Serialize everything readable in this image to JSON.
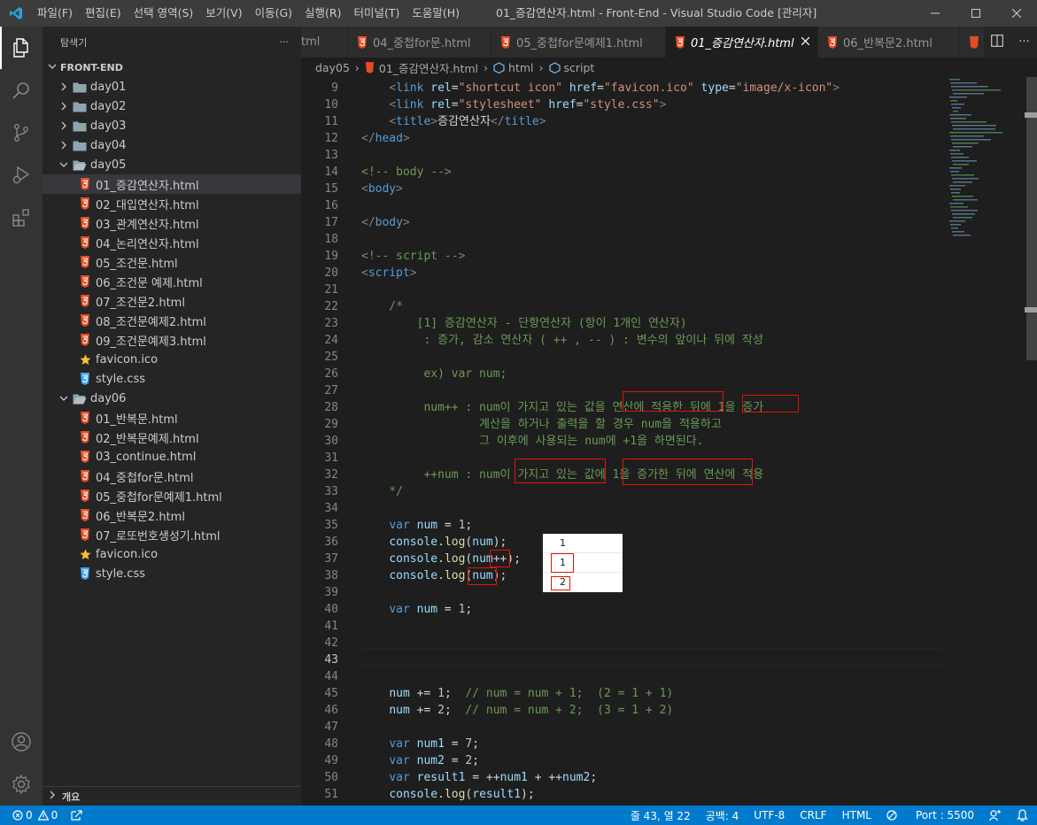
{
  "title_bar": {
    "menu": [
      "파일(F)",
      "편집(E)",
      "선택 영역(S)",
      "보기(V)",
      "이동(G)",
      "실행(R)",
      "터미널(T)",
      "도움말(H)"
    ],
    "window_title": "01_증감연산자.html - Front-End - Visual Studio Code [관리자]"
  },
  "sidebar": {
    "header": "탐색기",
    "more": "···",
    "root": "FRONT-END",
    "items": [
      {
        "label": "day01",
        "type": "folder-closed",
        "indent": 0
      },
      {
        "label": "day02",
        "type": "folder-closed",
        "indent": 0
      },
      {
        "label": "day03",
        "type": "folder-closed",
        "indent": 0
      },
      {
        "label": "day04",
        "type": "folder-closed",
        "indent": 0
      },
      {
        "label": "day05",
        "type": "folder-open",
        "indent": 0
      },
      {
        "label": "01_증감연산자.html",
        "type": "html",
        "indent": 1,
        "selected": true
      },
      {
        "label": "02_대입연산자.html",
        "type": "html",
        "indent": 1
      },
      {
        "label": "03_관계연산자.html",
        "type": "html",
        "indent": 1
      },
      {
        "label": "04_논리연산자.html",
        "type": "html",
        "indent": 1
      },
      {
        "label": "05_조건문.html",
        "type": "html",
        "indent": 1
      },
      {
        "label": "06_조건문 예제.html",
        "type": "html",
        "indent": 1
      },
      {
        "label": "07_조건문2.html",
        "type": "html",
        "indent": 1
      },
      {
        "label": "08_조건문예제2.html",
        "type": "html",
        "indent": 1
      },
      {
        "label": "09_조건문예제3.html",
        "type": "html",
        "indent": 1
      },
      {
        "label": "favicon.ico",
        "type": "star",
        "indent": 1
      },
      {
        "label": "style.css",
        "type": "css",
        "indent": 1
      },
      {
        "label": "day06",
        "type": "folder-open",
        "indent": 0
      },
      {
        "label": "01_반복문.html",
        "type": "html",
        "indent": 1
      },
      {
        "label": "02_반복문예제.html",
        "type": "html",
        "indent": 1
      },
      {
        "label": "03_continue.html",
        "type": "html",
        "indent": 1
      },
      {
        "label": "04_중첩for문.html",
        "type": "html",
        "indent": 1
      },
      {
        "label": "05_중첩for문예제1.html",
        "type": "html",
        "indent": 1
      },
      {
        "label": "06_반복문2.html",
        "type": "html",
        "indent": 1
      },
      {
        "label": "07_로또번호생성기.html",
        "type": "html",
        "indent": 1
      },
      {
        "label": "favicon.ico",
        "type": "star",
        "indent": 1
      },
      {
        "label": "style.css",
        "type": "css",
        "indent": 1
      }
    ],
    "footer": "개요"
  },
  "tabs": [
    {
      "label": "tml",
      "icon": false
    },
    {
      "label": "04_중첩for문.html",
      "icon": true
    },
    {
      "label": "05_중첩for문예제1.html",
      "icon": true
    },
    {
      "label": "01_증감연산자.html",
      "icon": true,
      "active": true
    },
    {
      "label": "06_반복문2.html",
      "icon": true
    }
  ],
  "breadcrumb": {
    "folder": "day05",
    "file": "01_증감연산자.html",
    "node1": "html",
    "node2": "script"
  },
  "editor": {
    "current_line": "43",
    "lines": [
      {
        "n": "9",
        "t": [
          [
            "pl",
            "    "
          ],
          [
            "br",
            "<"
          ],
          [
            "tg",
            "link"
          ],
          [
            "pl",
            " "
          ],
          [
            "at",
            "rel"
          ],
          [
            "pl",
            "="
          ],
          [
            "st",
            "\"shortcut icon\""
          ],
          [
            "pl",
            " "
          ],
          [
            "at",
            "href"
          ],
          [
            "pl",
            "="
          ],
          [
            "st",
            "\"favicon.ico\""
          ],
          [
            "pl",
            " "
          ],
          [
            "at",
            "type"
          ],
          [
            "pl",
            "="
          ],
          [
            "st",
            "\"image/x-icon\""
          ],
          [
            "br",
            ">"
          ]
        ]
      },
      {
        "n": "10",
        "t": [
          [
            "pl",
            "    "
          ],
          [
            "br",
            "<"
          ],
          [
            "tg",
            "link"
          ],
          [
            "pl",
            " "
          ],
          [
            "at",
            "rel"
          ],
          [
            "pl",
            "="
          ],
          [
            "st",
            "\"stylesheet\""
          ],
          [
            "pl",
            " "
          ],
          [
            "at",
            "href"
          ],
          [
            "pl",
            "="
          ],
          [
            "st",
            "\"style.css\""
          ],
          [
            "br",
            ">"
          ]
        ]
      },
      {
        "n": "11",
        "t": [
          [
            "pl",
            "    "
          ],
          [
            "br",
            "<"
          ],
          [
            "tg",
            "title"
          ],
          [
            "br",
            ">"
          ],
          [
            "pl",
            "증감연산자"
          ],
          [
            "br",
            "</"
          ],
          [
            "tg",
            "title"
          ],
          [
            "br",
            ">"
          ]
        ]
      },
      {
        "n": "12",
        "t": [
          [
            "br",
            "</"
          ],
          [
            "tg",
            "head"
          ],
          [
            "br",
            ">"
          ]
        ]
      },
      {
        "n": "13",
        "t": []
      },
      {
        "n": "14",
        "t": [
          [
            "cm",
            "<!-- body -->"
          ]
        ]
      },
      {
        "n": "15",
        "t": [
          [
            "br",
            "<"
          ],
          [
            "tg",
            "body"
          ],
          [
            "br",
            ">"
          ]
        ]
      },
      {
        "n": "16",
        "t": []
      },
      {
        "n": "17",
        "t": [
          [
            "br",
            "</"
          ],
          [
            "tg",
            "body"
          ],
          [
            "br",
            ">"
          ]
        ]
      },
      {
        "n": "18",
        "t": []
      },
      {
        "n": "19",
        "t": [
          [
            "cm",
            "<!-- script -->"
          ]
        ]
      },
      {
        "n": "20",
        "t": [
          [
            "br",
            "<"
          ],
          [
            "tg",
            "script"
          ],
          [
            "br",
            ">"
          ]
        ]
      },
      {
        "n": "21",
        "t": []
      },
      {
        "n": "22",
        "t": [
          [
            "cm",
            "    /*"
          ]
        ]
      },
      {
        "n": "23",
        "t": [
          [
            "cm",
            "        [1] 증감연산자 - 단항연산자 (항이 1개인 연산자)"
          ]
        ]
      },
      {
        "n": "24",
        "t": [
          [
            "cm",
            "         : 증가, 감소 연산자 ( ++ , -- ) : 변수의 앞이나 뒤에 작성"
          ]
        ]
      },
      {
        "n": "25",
        "t": []
      },
      {
        "n": "26",
        "t": [
          [
            "cm",
            "         ex) var num;"
          ]
        ]
      },
      {
        "n": "27",
        "t": []
      },
      {
        "n": "28",
        "t": [
          [
            "cm",
            "         num++ : num이 가지고 있는 값을 연산에 적용한 뒤에 1을 증가"
          ]
        ]
      },
      {
        "n": "29",
        "t": [
          [
            "cm",
            "                 계산을 하거나 출력을 할 경우 num을 적용하고"
          ]
        ]
      },
      {
        "n": "30",
        "t": [
          [
            "cm",
            "                 그 이후에 사용되는 num에 +1을 하면된다."
          ]
        ]
      },
      {
        "n": "31",
        "t": []
      },
      {
        "n": "32",
        "t": [
          [
            "cm",
            "         ++num : num이 가지고 있는 값에 1을 증가한 뒤에 연산에 적용"
          ]
        ]
      },
      {
        "n": "33",
        "t": [
          [
            "cm",
            "    */"
          ]
        ]
      },
      {
        "n": "34",
        "t": []
      },
      {
        "n": "35",
        "t": [
          [
            "pl",
            "    "
          ],
          [
            "kw",
            "var"
          ],
          [
            "pl",
            " "
          ],
          [
            "vr",
            "num"
          ],
          [
            "pl",
            " = "
          ],
          [
            "nm",
            "1"
          ],
          [
            "pl",
            ";"
          ]
        ]
      },
      {
        "n": "36",
        "t": [
          [
            "pl",
            "    "
          ],
          [
            "vr",
            "console"
          ],
          [
            "pl",
            "."
          ],
          [
            "fn",
            "log"
          ],
          [
            "pl",
            "("
          ],
          [
            "vr",
            "num"
          ],
          [
            "pl",
            ");"
          ]
        ]
      },
      {
        "n": "37",
        "t": [
          [
            "pl",
            "    "
          ],
          [
            "vr",
            "console"
          ],
          [
            "pl",
            "."
          ],
          [
            "fn",
            "log"
          ],
          [
            "pl",
            "("
          ],
          [
            "vr",
            "num"
          ],
          [
            "pl",
            "++);"
          ]
        ]
      },
      {
        "n": "38",
        "t": [
          [
            "pl",
            "    "
          ],
          [
            "vr",
            "console"
          ],
          [
            "pl",
            "."
          ],
          [
            "fn",
            "log"
          ],
          [
            "pl",
            "("
          ],
          [
            "vr",
            "num"
          ],
          [
            "pl",
            ");"
          ]
        ]
      },
      {
        "n": "39",
        "t": []
      },
      {
        "n": "40",
        "t": [
          [
            "pl",
            "    "
          ],
          [
            "kw",
            "var"
          ],
          [
            "pl",
            " "
          ],
          [
            "vr",
            "num"
          ],
          [
            "pl",
            " = "
          ],
          [
            "nm",
            "1"
          ],
          [
            "pl",
            ";"
          ]
        ]
      },
      {
        "n": "41",
        "t": []
      },
      {
        "n": "42",
        "t": []
      },
      {
        "n": "43",
        "t": []
      },
      {
        "n": "44",
        "t": []
      },
      {
        "n": "45",
        "t": [
          [
            "pl",
            "    "
          ],
          [
            "vr",
            "num"
          ],
          [
            "pl",
            " += "
          ],
          [
            "nm",
            "1"
          ],
          [
            "pl",
            ";  "
          ],
          [
            "cm",
            "// num = num + 1;  (2 = 1 + 1)"
          ]
        ]
      },
      {
        "n": "46",
        "t": [
          [
            "pl",
            "    "
          ],
          [
            "vr",
            "num"
          ],
          [
            "pl",
            " += "
          ],
          [
            "nm",
            "2"
          ],
          [
            "pl",
            ";  "
          ],
          [
            "cm",
            "// num = num + 2;  (3 = 1 + 2)"
          ]
        ]
      },
      {
        "n": "47",
        "t": []
      },
      {
        "n": "48",
        "t": [
          [
            "pl",
            "    "
          ],
          [
            "kw",
            "var"
          ],
          [
            "pl",
            " "
          ],
          [
            "vr",
            "num1"
          ],
          [
            "pl",
            " = "
          ],
          [
            "nm",
            "7"
          ],
          [
            "pl",
            ";"
          ]
        ]
      },
      {
        "n": "49",
        "t": [
          [
            "pl",
            "    "
          ],
          [
            "kw",
            "var"
          ],
          [
            "pl",
            " "
          ],
          [
            "vr",
            "num2"
          ],
          [
            "pl",
            " = "
          ],
          [
            "nm",
            "2"
          ],
          [
            "pl",
            ";"
          ]
        ]
      },
      {
        "n": "50",
        "t": [
          [
            "pl",
            "    "
          ],
          [
            "kw",
            "var"
          ],
          [
            "pl",
            " "
          ],
          [
            "vr",
            "result1"
          ],
          [
            "pl",
            " = ++"
          ],
          [
            "vr",
            "num1"
          ],
          [
            "pl",
            " + ++"
          ],
          [
            "vr",
            "num2"
          ],
          [
            "pl",
            ";"
          ]
        ]
      },
      {
        "n": "51",
        "t": [
          [
            "pl",
            "    "
          ],
          [
            "vr",
            "console"
          ],
          [
            "pl",
            "."
          ],
          [
            "fn",
            "log"
          ],
          [
            "pl",
            "("
          ],
          [
            "vr",
            "result1"
          ],
          [
            "pl",
            ");"
          ]
        ]
      }
    ],
    "console_output": [
      "1",
      "1",
      "2"
    ]
  },
  "status_bar": {
    "errors": "0",
    "warnings": "0",
    "position": "줄 43, 열 22",
    "spaces": "공백: 4",
    "encoding": "UTF-8",
    "eol": "CRLF",
    "language": "HTML",
    "port": "Port : 5500"
  }
}
